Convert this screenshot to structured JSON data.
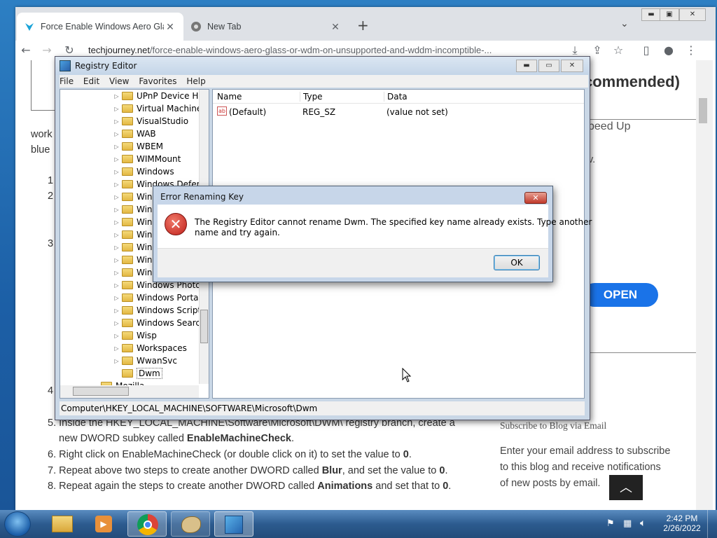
{
  "browser": {
    "tabs": [
      {
        "title": "Force Enable Windows Aero Glas",
        "active": true
      },
      {
        "title": "New Tab",
        "active": false
      }
    ],
    "new_tab": "+",
    "url_host": "techjourney.net",
    "url_path": "/force-enable-windows-aero-glass-or-wdm-on-unsupported-and-wddm-incomptible-..."
  },
  "webpage": {
    "heading_right": "commended)",
    "speed_up": "peed Up",
    "w_text": "v.",
    "intro_left_1": "work",
    "intro_left_2": "blue",
    "step_numbers": [
      "1",
      "2",
      "3",
      "4"
    ],
    "open_button": "OPEN",
    "steps": [
      {
        "num": "5.",
        "text_before": "Inside the HKEY_LOCAL_MACHINE\\Software\\Microsoft\\DWM\\ registry branch, create a",
        "line2": "new DWORD subkey called ",
        "bold": "EnableMachineCheck",
        "after": "."
      },
      {
        "num": "6.",
        "text_before": "Right click on EnableMachineCheck (or double click on it) to set the value to ",
        "bold": "0",
        "after": "."
      },
      {
        "num": "7.",
        "text_before": "Repeat above two steps to create another DWORD called ",
        "bold": "Blur",
        "after": ", and set the value to ",
        "bold2": "0",
        "after2": "."
      },
      {
        "num": "8.",
        "text_before": "Repeat again the steps to create another DWORD called ",
        "bold": "Animations",
        "after": " and set that to ",
        "bold2": "0",
        "after2": "."
      }
    ],
    "sidebar_heading": "Subscribe to Blog via Email",
    "sidebar_text": [
      "Enter your email address to subscribe",
      "to this blog and receive notifications",
      "of new posts by email."
    ]
  },
  "regedit": {
    "title": "Registry Editor",
    "menu": [
      "File",
      "Edit",
      "View",
      "Favorites",
      "Help"
    ],
    "tree": [
      "UPnP Device Ho",
      "Virtual Machine",
      "VisualStudio",
      "WAB",
      "WBEM",
      "WIMMount",
      "Windows",
      "Windows Defen",
      "Win",
      "Win",
      "Win",
      "Win",
      "Win",
      "Win",
      "Win",
      "Windows Photo",
      "Windows Portal",
      "Windows Script",
      "Windows Search",
      "Wisp",
      "Workspaces",
      "WwanSvc",
      "Dwm"
    ],
    "tree_below": "Mozilla",
    "columns": [
      "Name",
      "Type",
      "Data"
    ],
    "values": [
      {
        "name": "(Default)",
        "type": "REG_SZ",
        "data": "(value not set)"
      }
    ],
    "status_path": "Computer\\HKEY_LOCAL_MACHINE\\SOFTWARE\\Microsoft\\Dwm"
  },
  "dialog": {
    "title": "Error Renaming Key",
    "message_line1": "The Registry Editor cannot rename Dwm. The specified key name already exists. Type another",
    "message_line2": "name and try again.",
    "ok": "OK"
  },
  "taskbar": {
    "time": "2:42 PM",
    "date": "2/26/2022"
  }
}
